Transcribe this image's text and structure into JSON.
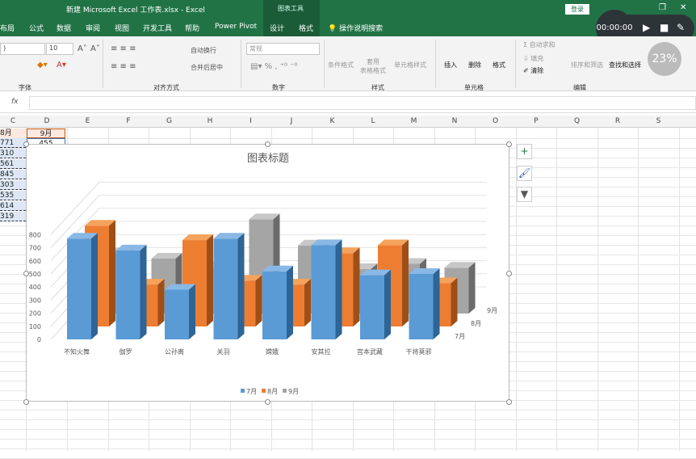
{
  "window": {
    "title": "新建 Microsoft Excel 工作表.xlsx  -  Excel",
    "context_tab": "图表工具",
    "login": "登录"
  },
  "tabs": [
    "布局",
    "公式",
    "数据",
    "审阅",
    "视图",
    "开发工具",
    "帮助",
    "Power Pivot",
    "设计",
    "格式"
  ],
  "tell_me": "操作说明搜索",
  "recorder": {
    "time": "00:00:00"
  },
  "gauge": "23%",
  "ribbon": {
    "font_size": "10",
    "number_format": "常规",
    "wrap": "自动换行",
    "merge": "合并后居中",
    "cond_format": "条件格式",
    "table_format": "套用\n表格格式",
    "cell_style": "单元格样式",
    "insert": "插入",
    "delete": "删除",
    "format": "格式",
    "autosum": "自动求和",
    "fill": "填充",
    "clear": "清除",
    "sort": "排序和筛选",
    "find": "查找和选择",
    "groups": [
      "字体",
      "对齐方式",
      "数字",
      "样式",
      "单元格",
      "编辑"
    ]
  },
  "formula_bar": {
    "fx": "fx",
    "value": ""
  },
  "columns": [
    "C",
    "D",
    "E",
    "F",
    "G",
    "H",
    "I",
    "J",
    "K",
    "L",
    "M",
    "N",
    "O",
    "P",
    "Q",
    "R",
    "S"
  ],
  "cells": {
    "C1": "8月",
    "D1": "9月",
    "D2": "455",
    "C": [
      "771",
      "310",
      "561",
      "845",
      "303",
      "535",
      "614",
      "319"
    ]
  },
  "chart_data": {
    "type": "bar3d",
    "title": "图表标题",
    "categories": [
      "不知火舞",
      "伽罗",
      "公孙离",
      "关羽",
      "嫦娥",
      "安其拉",
      "宫本武藏",
      "干将莫邪"
    ],
    "series": [
      {
        "name": "7月",
        "color": "#5b9bd5",
        "values": [
          770,
          680,
          380,
          770,
          520,
          720,
          490,
          500
        ]
      },
      {
        "name": "8月",
        "color": "#ed7d31",
        "values": [
          770,
          320,
          660,
          350,
          320,
          560,
          620,
          330
        ]
      },
      {
        "name": "9月",
        "color": "#a5a5a5",
        "values": [
          460,
          420,
          350,
          720,
          520,
          340,
          380,
          350
        ]
      }
    ],
    "yticks": [
      "0",
      "100",
      "200",
      "300",
      "400",
      "500",
      "600",
      "700",
      "800"
    ],
    "depth_labels": [
      "7月",
      "8月",
      "9月"
    ],
    "ylim": [
      0,
      800
    ],
    "legend": "bottom",
    "grid": true
  }
}
